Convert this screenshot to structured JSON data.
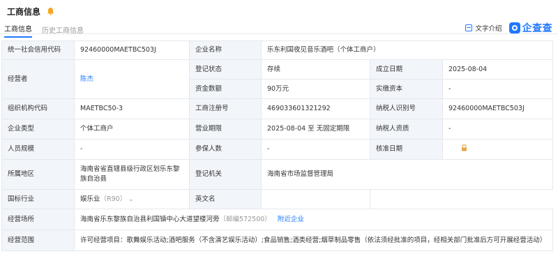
{
  "header": {
    "title": "工商信息"
  },
  "tabs": [
    {
      "label": "工商信息"
    },
    {
      "label": "历史工商信息"
    }
  ],
  "tools": {
    "text_intro": "文字介绍",
    "logo_text": "企查查"
  },
  "rows": {
    "credit_code_label": "统一社会信用代码",
    "credit_code": "92460000MAETBC503J",
    "company_name_label": "企业名称",
    "company_name": "乐东利国夜见音乐酒吧（个体工商户）",
    "operator_label": "经营者",
    "operator": "陈杰",
    "reg_status_label": "登记状态",
    "reg_status": "存续",
    "est_date_label": "成立日期",
    "est_date": "2025-08-04",
    "capital_label": "资金数额",
    "capital": "90万元",
    "paid_capital_label": "实缴资本",
    "paid_capital": "-",
    "org_code_label": "组织机构代码",
    "org_code": "MAETBC50-3",
    "reg_no_label": "工商注册号",
    "reg_no": "469033601321292",
    "taxpayer_id_label": "纳税人识别号",
    "taxpayer_id": "92460000MAETBC503J",
    "type_label": "企业类型",
    "type": "个体工商户",
    "term_label": "营业期限",
    "term": "2025-08-04 至 无固定期限",
    "taxpayer_qual_label": "纳税人资质",
    "taxpayer_qual": "-",
    "staff_label": "人员规模",
    "staff": "-",
    "insured_label": "参保人数",
    "insured": "-",
    "approve_date_label": "核准日期",
    "region_label": "所属地区",
    "region": "海南省省直辖县级行政区划乐东黎族自治县",
    "authority_label": "登记机关",
    "authority": "海南省市场监督管理局",
    "industry_label": "国标行业",
    "industry": "娱乐业",
    "industry_code": "（R90）",
    "english_name_label": "英文名",
    "address_label": "经营场所",
    "address": "海南省乐东黎族自治县利国镇中心大道望楼河旁",
    "postcode": "（邮编572500）",
    "nearby": "附近企业",
    "scope_label": "经营范围",
    "scope": "许可经营项目：歌舞娱乐活动;酒吧服务（不含演艺娱乐活动）;食品销售;酒类经营;烟草制品零售（依法须经批准的项目，经相关部门批准后方可开展经营活动）"
  },
  "colors": {
    "accent": "#1f78ff",
    "label_bg": "#f2f5fa",
    "border": "#e4e8ef",
    "bell": "#f5a623",
    "lock": "#e8a54a"
  },
  "icons": [
    "bell-icon",
    "doc-icon",
    "qcc-logo-icon",
    "chevron-down-icon",
    "lock-icon"
  ]
}
